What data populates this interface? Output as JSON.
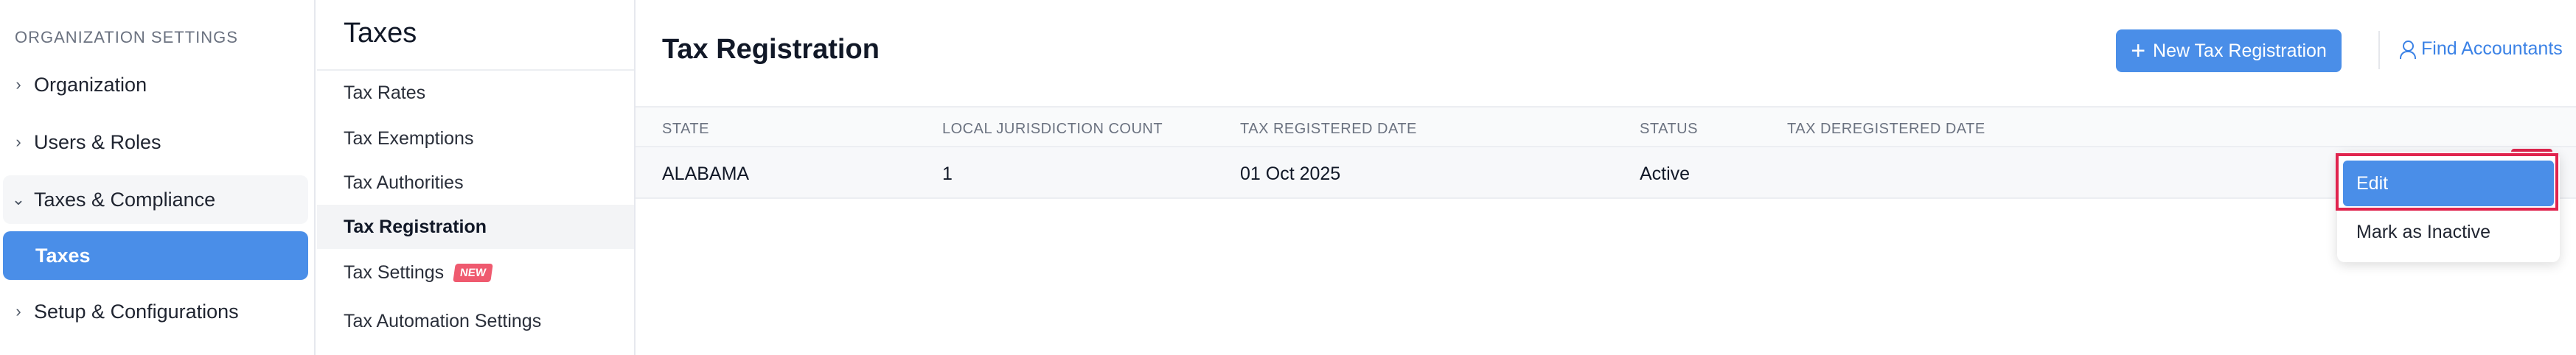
{
  "org_sidebar": {
    "heading": "ORGANIZATION SETTINGS",
    "items": [
      {
        "label": "Organization",
        "expanded": false
      },
      {
        "label": "Users & Roles",
        "expanded": false
      },
      {
        "label": "Taxes & Compliance",
        "expanded": true
      },
      {
        "label": "Taxes",
        "active": true
      },
      {
        "label": "Setup & Configurations",
        "expanded": false
      }
    ]
  },
  "tax_sidebar": {
    "title": "Taxes",
    "items": [
      {
        "label": "Tax Rates"
      },
      {
        "label": "Tax Exemptions"
      },
      {
        "label": "Tax Authorities"
      },
      {
        "label": "Tax Registration",
        "active": true
      },
      {
        "label": "Tax Settings",
        "badge": "NEW"
      },
      {
        "label": "Tax Automation Settings"
      }
    ]
  },
  "main": {
    "title": "Tax Registration",
    "new_button_label": "New Tax Registration",
    "find_accountants_label": "Find Accountants",
    "table": {
      "columns": [
        "STATE",
        "LOCAL JURISDICTION COUNT",
        "TAX REGISTERED DATE",
        "STATUS",
        "TAX DEREGISTERED DATE"
      ],
      "rows": [
        {
          "state": "ALABAMA",
          "local_jurisdiction_count": "1",
          "tax_registered_date": "01 Oct 2025",
          "status": "Active",
          "tax_deregistered_date": ""
        }
      ]
    },
    "row_menu": {
      "items": [
        {
          "label": "Edit",
          "hover": true
        },
        {
          "label": "Mark as Inactive"
        }
      ]
    }
  },
  "colors": {
    "accent": "#4a8ee8",
    "highlight": "#e0244e",
    "badge": "#ef5a6f"
  }
}
